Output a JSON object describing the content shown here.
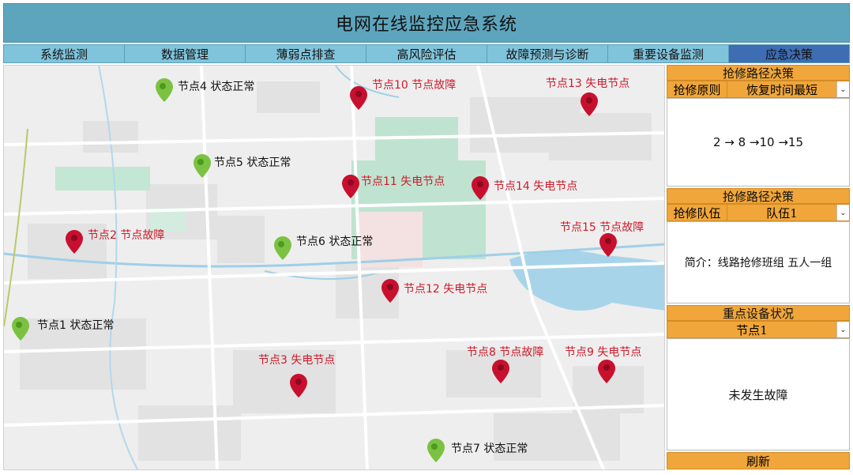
{
  "app": {
    "title": "电网在线监控应急系统"
  },
  "tabs": [
    {
      "label": "系统监测"
    },
    {
      "label": "数据管理"
    },
    {
      "label": "薄弱点排查"
    },
    {
      "label": "高风险评估"
    },
    {
      "label": "故障预测与诊断"
    },
    {
      "label": "重要设备监测"
    },
    {
      "label": "应急决策",
      "active": true
    }
  ],
  "colors": {
    "normal_pin": "#7cc242",
    "fault_pin": "#c8102e",
    "accent": "#f0a63a",
    "title_bg": "#5da5bd",
    "tab_bg": "#80c4dc",
    "active_tab": "#3e6db3"
  },
  "nodes": [
    {
      "label": "节点4 状态正常",
      "status": "normal"
    },
    {
      "label": "节点10 节点故障",
      "status": "fault"
    },
    {
      "label": "节点13 失电节点",
      "status": "fault"
    },
    {
      "label": "节点5 状态正常",
      "status": "normal"
    },
    {
      "label": "节点11 失电节点",
      "status": "fault"
    },
    {
      "label": "节点14 失电节点",
      "status": "fault"
    },
    {
      "label": "节点2 节点故障",
      "status": "fault"
    },
    {
      "label": "节点6 状态正常",
      "status": "normal"
    },
    {
      "label": "节点15 节点故障",
      "status": "fault"
    },
    {
      "label": "节点12 失电节点",
      "status": "fault"
    },
    {
      "label": "节点1 状态正常",
      "status": "normal"
    },
    {
      "label": "节点3 失电节点",
      "status": "fault"
    },
    {
      "label": "节点8 节点故障",
      "status": "fault"
    },
    {
      "label": "节点9 失电节点",
      "status": "fault"
    },
    {
      "label": "节点7 状态正常",
      "status": "normal"
    }
  ],
  "panel": {
    "route": {
      "heading": "抢修路径决策",
      "key": "抢修原则",
      "value": "恢复时间最短",
      "result": "2 → 8 →10 →15"
    },
    "team": {
      "heading": "抢修路径决策",
      "key": "抢修队伍",
      "value": "队伍1",
      "result": "简介：线路抢修班组 五人一组"
    },
    "device": {
      "heading": "重点设备状况",
      "value": "节点1",
      "result": "未发生故障"
    },
    "refresh_label": "刷新"
  }
}
